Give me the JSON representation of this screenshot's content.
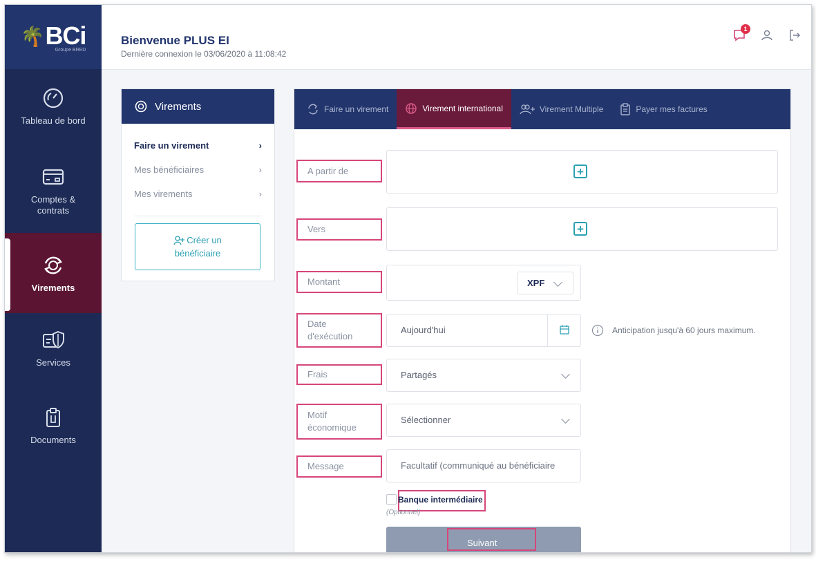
{
  "sidebar": {
    "logo": "BCi",
    "logo_sub": "Groupe BRED",
    "items": [
      {
        "label": "Tableau de bord",
        "icon": "gauge-icon"
      },
      {
        "label": "Comptes & contrats",
        "icon": "card-icon"
      },
      {
        "label": "Virements",
        "icon": "transfer-icon",
        "active": true
      },
      {
        "label": "Services",
        "icon": "shield-card-icon"
      },
      {
        "label": "Documents",
        "icon": "clipboard-icon"
      }
    ]
  },
  "header": {
    "welcome": "Bienvenue PLUS EI",
    "last_login": "Dernière connexion le 03/06/2020 à 11:08:42",
    "notif_count": "1"
  },
  "left_panel": {
    "title": "Virements",
    "menu": [
      {
        "label": "Faire un virement",
        "selected": true
      },
      {
        "label": "Mes bénéficiaires"
      },
      {
        "label": "Mes virements"
      }
    ],
    "create_line1": "Créer un",
    "create_line2": "bénéficiaire"
  },
  "tabs": [
    {
      "label": "Faire un virement"
    },
    {
      "label": "Virement international",
      "active": true
    },
    {
      "label": "Virement Multiple"
    },
    {
      "label": "Payer mes factures"
    }
  ],
  "form": {
    "from_label": "A partir de",
    "to_label": "Vers",
    "amount_label": "Montant",
    "currency": "XPF",
    "date_label_1": "Date",
    "date_label_2": "d'exécution",
    "date_value": "Aujourd'hui",
    "date_info": "Anticipation jusqu'à 60 jours maximum.",
    "fees_label": "Frais",
    "fees_value": "Partagés",
    "reason_label_1": "Motif",
    "reason_label_2": "économique",
    "reason_value": "Sélectionner",
    "message_label": "Message",
    "message_placeholder": "Facultatif (communiqué au bénéficiaire",
    "intermediary_label": "Banque intermédiaire",
    "optional": "(Optionnel)",
    "next_button": "Suivant"
  },
  "colors": {
    "sidebar": "#1c2a55",
    "accent_active": "#5b1533",
    "highlight": "#d6467a",
    "teal": "#2ba0b3"
  }
}
